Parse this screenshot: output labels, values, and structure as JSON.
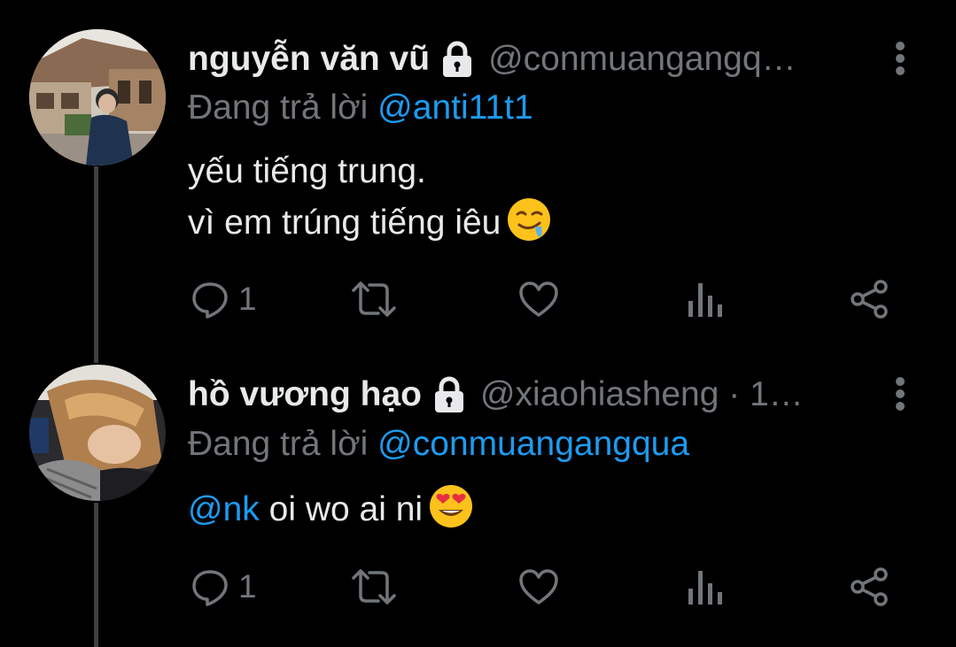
{
  "tweets": [
    {
      "name": "nguyễn văn vũ",
      "handle": "@conmuangangq…",
      "reply_prefix": "Đang trả lời",
      "reply_to": "@anti11t1",
      "lines": [
        "yếu tiếng trung.",
        "vì em trúng tiếng iêu"
      ],
      "emoji": "drooling-face",
      "reply_count": "1",
      "icons": [
        "lock-icon",
        "more-vertical-icon",
        "reply-icon",
        "retweet-icon",
        "like-icon",
        "analytics-icon",
        "share-icon"
      ]
    },
    {
      "name": "hồ vương hạo",
      "handle": "@xiaohiasheng · 1…",
      "reply_prefix": "Đang trả lời",
      "reply_to": "@conmuangangqua",
      "mention": "@nk",
      "text": "oi wo ai ni",
      "emoji": "heart-eyes-face",
      "reply_count": "1",
      "icons": [
        "lock-icon",
        "more-vertical-icon",
        "reply-icon",
        "retweet-icon",
        "like-icon",
        "analytics-icon",
        "share-icon"
      ]
    }
  ],
  "colors": {
    "background": "#000000",
    "text": "#e7e9ea",
    "secondary": "#71767b",
    "link": "#1d9bf0",
    "thread_line": "#3e4144"
  }
}
